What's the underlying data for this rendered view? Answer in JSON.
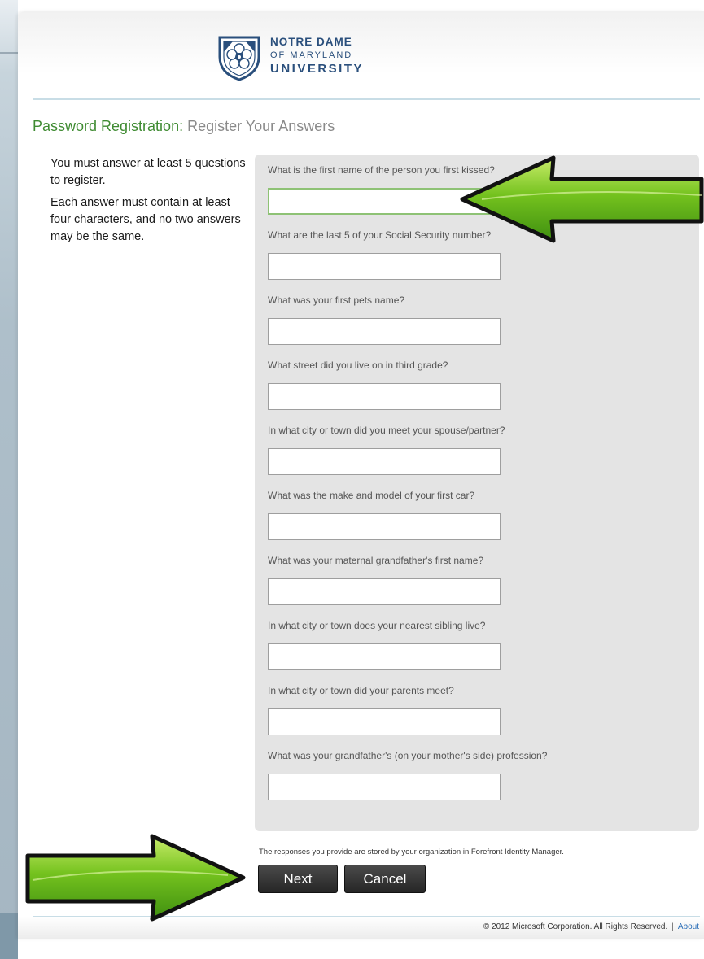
{
  "header": {
    "logo_lines": [
      "NOTRE DAME",
      "OF MARYLAND",
      "UNIVERSITY"
    ]
  },
  "page_title": {
    "section": "Password Registration:",
    "step": "Register Your Answers"
  },
  "instructions": [
    "You must answer at least 5 questions to register.",
    "Each answer must contain at least four characters, and no two answers may be the same."
  ],
  "questions": [
    {
      "label": "What is the first name of the person you first kissed?",
      "value": ""
    },
    {
      "label": "What are the last 5 of your Social Security number?",
      "value": ""
    },
    {
      "label": "What was your first pets name?",
      "value": ""
    },
    {
      "label": "What street did you live on in third grade?",
      "value": ""
    },
    {
      "label": "In what city or town did you meet your spouse/partner?",
      "value": ""
    },
    {
      "label": "What was the make and model of your first car?",
      "value": ""
    },
    {
      "label": "What was your maternal grandfather's first name?",
      "value": ""
    },
    {
      "label": "In what city or town does your nearest sibling live?",
      "value": ""
    },
    {
      "label": "In what city or town did your parents meet?",
      "value": ""
    },
    {
      "label": "What was your grandfather's (on your mother's side) profession?",
      "value": ""
    }
  ],
  "disclaimer": "The responses you provide are stored by your organization in Forefront Identity Manager.",
  "buttons": {
    "next": "Next",
    "cancel": "Cancel"
  },
  "footer": {
    "copyright": "© 2012 Microsoft Corporation. All Rights Reserved.",
    "separator": "|",
    "about": "About"
  },
  "colors": {
    "title_green": "#3f8b32",
    "arrow_green": "#6fbf1f",
    "panel_gray": "#e4e4e4",
    "focus_border": "#8ec275"
  }
}
